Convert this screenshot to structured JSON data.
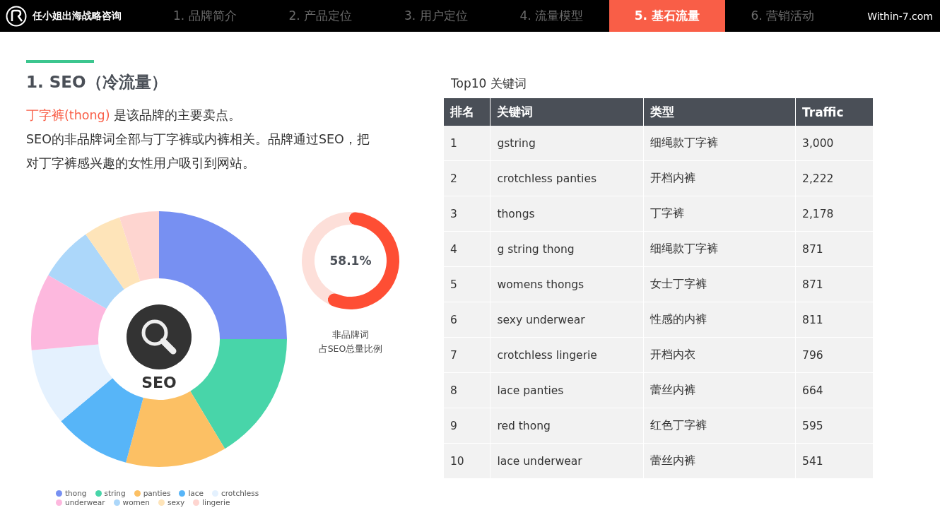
{
  "header": {
    "brand": "任小姐出海战略咨询",
    "site": "Within-7.com",
    "tabs": [
      {
        "label": "1. 品牌简介",
        "selected": false
      },
      {
        "label": "2. 产品定位",
        "selected": false
      },
      {
        "label": "3. 用户定位",
        "selected": false
      },
      {
        "label": "4. 流量模型",
        "selected": false
      },
      {
        "label": "5. 基石流量",
        "selected": true
      },
      {
        "label": "6. 营销活动",
        "selected": false
      }
    ]
  },
  "section": {
    "title": "1. SEO（冷流量）",
    "highlight": "丁字裤(thong)",
    "lead": "是该品牌的主要卖点。",
    "body": "SEO的非品牌词全部与丁字裤或内裤相关。品牌通过SEO，把对丁字裤感兴趣的女性用户吸引到网站。"
  },
  "donut": {
    "center_label": "SEO",
    "legend": [
      {
        "label": "thong",
        "color": "#7790f2"
      },
      {
        "label": "string",
        "color": "#48d5a9"
      },
      {
        "label": "panties",
        "color": "#fcc064"
      },
      {
        "label": "lace",
        "color": "#57b5f8"
      },
      {
        "label": "crotchless",
        "color": "#e4f1fe"
      },
      {
        "label": "underwear",
        "color": "#fdb8de"
      },
      {
        "label": "women",
        "color": "#acd7fa"
      },
      {
        "label": "sexy",
        "color": "#fee4b9"
      },
      {
        "label": "lingerie",
        "color": "#fed5d0"
      }
    ]
  },
  "gauge": {
    "reading": "58.1%",
    "chart_data": {
      "type": "donut",
      "values": [
        58.1,
        41.9
      ]
    },
    "caption_lines": [
      "非品牌词",
      "占SEO总量比例"
    ]
  },
  "table": {
    "title": "Top10 关键词",
    "columns": [
      "排名",
      "关键词",
      "类型",
      "Traffic"
    ],
    "rows": [
      [
        "1",
        "gstring",
        "细绳款丁字裤",
        "3,000"
      ],
      [
        "2",
        "crotchless panties",
        "开档内裤",
        "2,222"
      ],
      [
        "3",
        "thongs",
        "丁字裤",
        "2,178"
      ],
      [
        "4",
        "g string thong",
        "细绳款丁字裤",
        "871"
      ],
      [
        "5",
        "womens thongs",
        "女士丁字裤",
        "871"
      ],
      [
        "6",
        "sexy underwear",
        "性感的内裤",
        "811"
      ],
      [
        "7",
        "crotchless lingerie",
        "开档内衣",
        "796"
      ],
      [
        "8",
        "lace panties",
        "蕾丝内裤",
        "664"
      ],
      [
        "9",
        "red thong",
        "红色丁字裤",
        "595"
      ],
      [
        "10",
        "lace underwear",
        "蕾丝内裤",
        "541"
      ]
    ]
  }
}
